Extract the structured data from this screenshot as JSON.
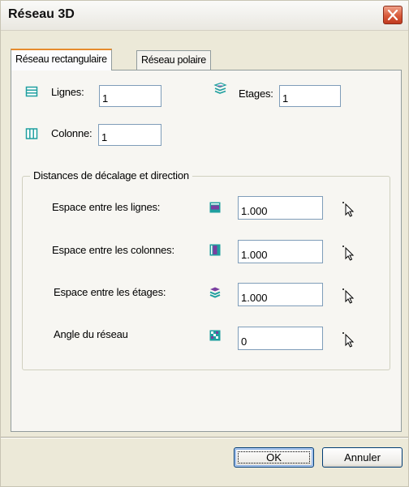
{
  "window": {
    "title": "Réseau 3D"
  },
  "tabs": [
    {
      "label": "Réseau rectangulaire",
      "active": true
    },
    {
      "label": "Réseau polaire",
      "active": false
    }
  ],
  "rect": {
    "lignes_label": "Lignes:",
    "lignes_value": "1",
    "etages_label": "Etages:",
    "etages_value": "1",
    "colonne_label": "Colonne:",
    "colonne_value": "1"
  },
  "distances": {
    "legend": "Distances de décalage et direction",
    "rows": [
      {
        "label": "Espace entre les lignes:",
        "value": "1.000",
        "icon": "row-spacing-icon"
      },
      {
        "label": "Espace entre les colonnes:",
        "value": "1.000",
        "icon": "column-spacing-icon"
      },
      {
        "label": "Espace entre les étages:",
        "value": "1.000",
        "icon": "level-spacing-icon"
      },
      {
        "label": "Angle du réseau",
        "value": "0",
        "icon": "array-angle-icon"
      }
    ]
  },
  "buttons": {
    "ok": "OK",
    "cancel": "Annuler"
  },
  "colors": {
    "icon_teal": "#1f9f9f",
    "icon_purple": "#7a3fa0",
    "close_red": "#d85a3a"
  }
}
